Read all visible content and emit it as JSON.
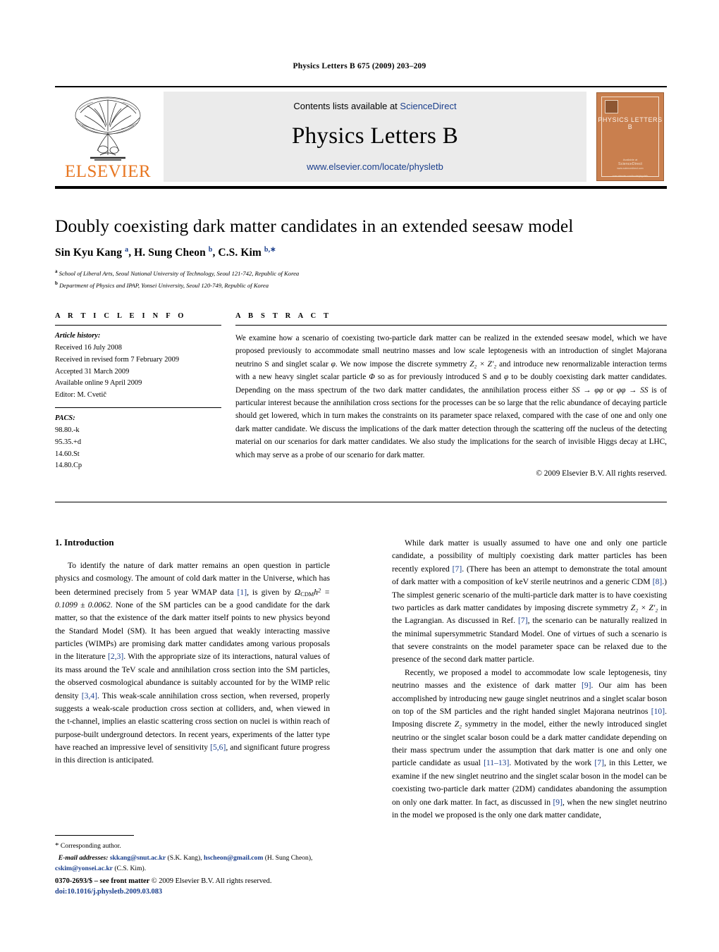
{
  "running_head": "Physics Letters B 675 (2009) 203–209",
  "masthead": {
    "contents_prefix": "Contents lists available at ",
    "contents_link": "ScienceDirect",
    "journal_title": "Physics Letters B",
    "journal_url": "www.elsevier.com/locate/physletb",
    "publisher": "ELSEVIER",
    "cover": {
      "title": "PHYSICS LETTERS B",
      "foot1": "Available at",
      "foot2": "ScienceDirect",
      "foot3": "www.sciencedirect.com",
      "foot4": "www.elsevier.com/locate/physletb"
    }
  },
  "article": {
    "title": "Doubly coexisting dark matter candidates in an extended seesaw model",
    "authors_html": "Sin Kyu Kang <sup>a</sup>, H. Sung Cheon <sup>b</sup>, C.S. Kim <sup>b,∗</sup>",
    "affiliation_a": "School of Liberal Arts, Seoul National University of Technology, Seoul 121-742, Republic of Korea",
    "affiliation_b": "Department of Physics and IPAP, Yonsei University, Seoul 120-749, Republic of Korea"
  },
  "info": {
    "heading": "A R T I C L E   I N F O",
    "history_label": "Article history:",
    "received": "Received 16 July 2008",
    "revised": "Received in revised form 7 February 2009",
    "accepted": "Accepted 31 March 2009",
    "online": "Available online 9 April 2009",
    "editor": "Editor: M. Cvetič",
    "pacs_label": "PACS:",
    "pacs": [
      "98.80.-k",
      "95.35.+d",
      "14.60.St",
      "14.80.Cp"
    ]
  },
  "abstract": {
    "heading": "A B S T R A C T",
    "p1_a": "We examine how a scenario of coexisting two-particle dark matter can be realized in the extended seesaw model, which we have proposed previously to accommodate small neutrino masses and low scale leptogenesis with an introduction of singlet Majorana neutrino S and singlet scalar ",
    "p1_phi": "φ",
    "p1_b": ". We now impose the discrete symmetry ",
    "p1_sym": "Z₂ × Z′₂",
    "p1_c": " and introduce new renormalizable interaction terms with a new heavy singlet scalar particle ",
    "p1_Phi": "Φ",
    "p1_d": " so as for previously introduced S and ",
    "p1_e": " to be doubly coexisting dark matter candidates. Depending on the mass spectrum of the two dark matter candidates, the annihilation process either ",
    "p1_proc1": "SS → φφ",
    "p1_f": " or ",
    "p1_proc2": "φφ → SS",
    "p1_g": " is of particular interest because the annihilation cross sections for the processes can be so large that the relic abundance of decaying particle should get lowered, which in turn makes the constraints on its parameter space relaxed, compared with the case of one and only one dark matter candidate. We discuss the implications of the dark matter detection through the scattering off the nucleus of the detecting material on our scenarios for dark matter candidates. We also study the implications for the search of invisible Higgs decay at LHC, which may serve as a probe of our scenario for dark matter.",
    "copyright": "© 2009 Elsevier B.V. All rights reserved."
  },
  "body": {
    "section_heading": "1. Introduction",
    "left_p1_a": "To identify the nature of dark matter remains an open question in particle physics and cosmology. The amount of cold dark matter in the Universe, which has been determined precisely from 5 year WMAP data ",
    "left_p1_ref1": "[1]",
    "left_p1_b": ", is given by ",
    "left_p1_eq": "ΩCDMh² = 0.1099 ± 0.0062",
    "left_p1_c": ". None of the SM particles can be a good candidate for the dark matter, so that the existence of the dark matter itself points to new physics beyond the Standard Model (SM). It has been argued that weakly interacting massive particles (WIMPs) are promising dark matter candidates among various proposals in the literature ",
    "left_p1_ref2": "[2,3]",
    "left_p1_d": ". With the appropriate size of its interactions, natural values of its mass around the TeV scale and annihilation cross section into the SM particles, the observed cosmological abundance is suitably accounted for by the WIMP relic density ",
    "left_p1_ref3": "[3,4]",
    "left_p1_e": ". This weak-scale annihilation cross section, when reversed, properly suggests a weak-scale production cross section at colliders, and, when viewed in the t-channel, implies an elastic scattering cross section on nuclei is within reach of purpose-built underground detectors. In recent years, experiments of the latter type have reached an impressive level of sensitivity ",
    "left_p1_ref4": "[5,6]",
    "left_p1_f": ", and significant future progress in this direction is anticipated.",
    "right_p1_a": "While dark matter is usually assumed to have one and only one particle candidate, a possibility of multiply coexisting dark matter particles has been recently explored ",
    "right_p1_ref1": "[7]",
    "right_p1_b": ". (There has been an attempt to demonstrate the total amount of dark matter with a composition of keV sterile neutrinos and a generic CDM ",
    "right_p1_ref2": "[8]",
    "right_p1_c": ".) The simplest generic scenario of the multi-particle dark matter is to have coexisting two particles as dark matter candidates by imposing discrete symmetry ",
    "right_p1_sym": "Z₂ × Z′₂",
    "right_p1_d": " in the Lagrangian. As discussed in Ref. ",
    "right_p1_ref3": "[7]",
    "right_p1_e": ", the scenario can be naturally realized in the minimal supersymmetric Standard Model. One of virtues of such a scenario is that severe constraints on the model parameter space can be relaxed due to the presence of the second dark matter particle.",
    "right_p2_a": "Recently, we proposed a model to accommodate low scale leptogenesis, tiny neutrino masses and the existence of dark matter ",
    "right_p2_ref1": "[9]",
    "right_p2_b": ". Our aim has been accomplished by introducing new gauge singlet neutrinos and a singlet scalar boson on top of the SM particles and the right handed singlet Majorana neutrinos ",
    "right_p2_ref2": "[10]",
    "right_p2_c": ". Imposing discrete ",
    "right_p2_sym": "Z₂",
    "right_p2_d": " symmetry in the model, either the newly introduced singlet neutrino or the singlet scalar boson could be a dark matter candidate depending on their mass spectrum under the assumption that dark matter is one and only one particle candidate as usual ",
    "right_p2_ref3": "[11–13]",
    "right_p2_e": ". Motivated by the work ",
    "right_p2_ref4": "[7]",
    "right_p2_f": ", in this Letter, we examine if the new singlet neutrino and the singlet scalar boson in the model can be coexisting two-particle dark matter (2DM) candidates abandoning the assumption on only one dark matter. In fact, as discussed in ",
    "right_p2_ref5": "[9]",
    "right_p2_g": ", when the new singlet neutrino in the model we proposed is the only one dark matter candidate,"
  },
  "footnote": {
    "star": "*",
    "corresponding": "Corresponding author.",
    "email_label": "E-mail addresses:",
    "email1": "skkang@snut.ac.kr",
    "email1_who": "(S.K. Kang)",
    "email2": "hscheon@gmail.com",
    "email2_who": "(H. Sung Cheon)",
    "email3": "cskim@yonsei.ac.kr",
    "email3_who": "(C.S. Kim)"
  },
  "imprint": {
    "issn_line": "0370-2693/$ – see front matter",
    "copyright": "© 2009 Elsevier B.V. All rights reserved.",
    "doi": "doi:10.1016/j.physletb.2009.03.083"
  }
}
